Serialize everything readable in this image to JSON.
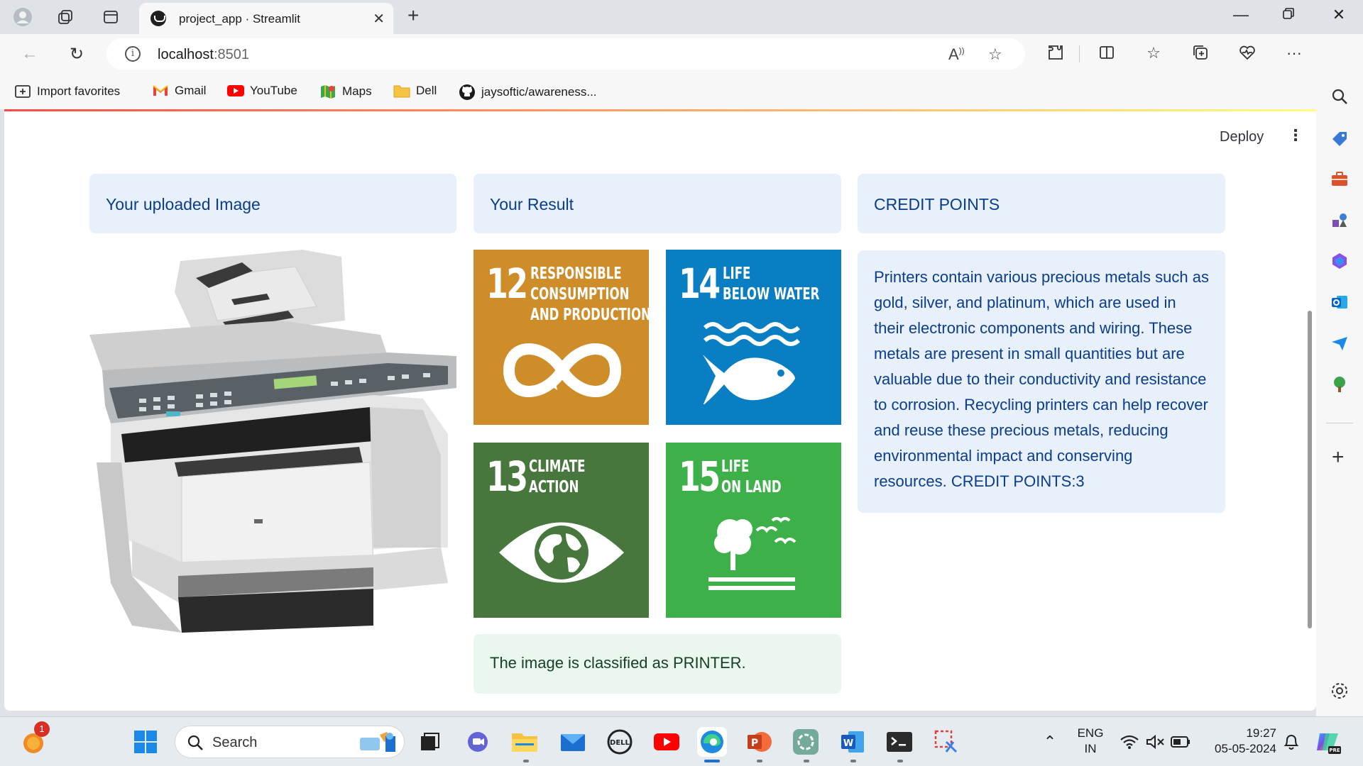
{
  "browser": {
    "tab_title": "project_app · Streamlit",
    "url_host": "localhost",
    "url_port": ":8501",
    "bookmarks": [
      "Import favorites",
      "Gmail",
      "YouTube",
      "Maps",
      "Dell",
      "jaysoftic/awareness..."
    ]
  },
  "app": {
    "deploy_label": "Deploy",
    "uploaded_header": "Your uploaded Image",
    "result_header": "Your Result",
    "credit_header": "CREDIT POINTS",
    "credit_text": "Printers contain various precious metals such as gold, silver, and platinum, which are used in their electronic components and wiring. These metals are present in small quantities but are valuable due to their conductivity and resistance to corrosion. Recycling printers can help recover and reuse these precious metals, reducing environmental impact and conserving resources. CREDIT POINTS:3",
    "classification_text": "The image is classified as PRINTER.",
    "sdg_tiles": [
      {
        "number": "12",
        "line1": "RESPONSIBLE",
        "line2": "CONSUMPTION",
        "line3": "AND PRODUCTION",
        "color": "#cf8d2a"
      },
      {
        "number": "14",
        "line1": "LIFE",
        "line2": "BELOW WATER",
        "line3": "",
        "color": "#0a7ec2"
      },
      {
        "number": "13",
        "line1": "CLIMATE",
        "line2": "ACTION",
        "line3": "",
        "color": "#48773e"
      },
      {
        "number": "15",
        "line1": "LIFE",
        "line2": "ON LAND",
        "line3": "",
        "color": "#3eb049"
      }
    ]
  },
  "taskbar": {
    "search_placeholder": "Search",
    "notification_badge": "1",
    "lang_line1": "ENG",
    "lang_line2": "IN",
    "time": "19:27",
    "date": "05-05-2024"
  },
  "colors": {
    "info_bg": "#e7f0fb",
    "info_text": "#0b3d8c",
    "success_bg": "#e9f7ee",
    "success_text": "#173f23"
  }
}
